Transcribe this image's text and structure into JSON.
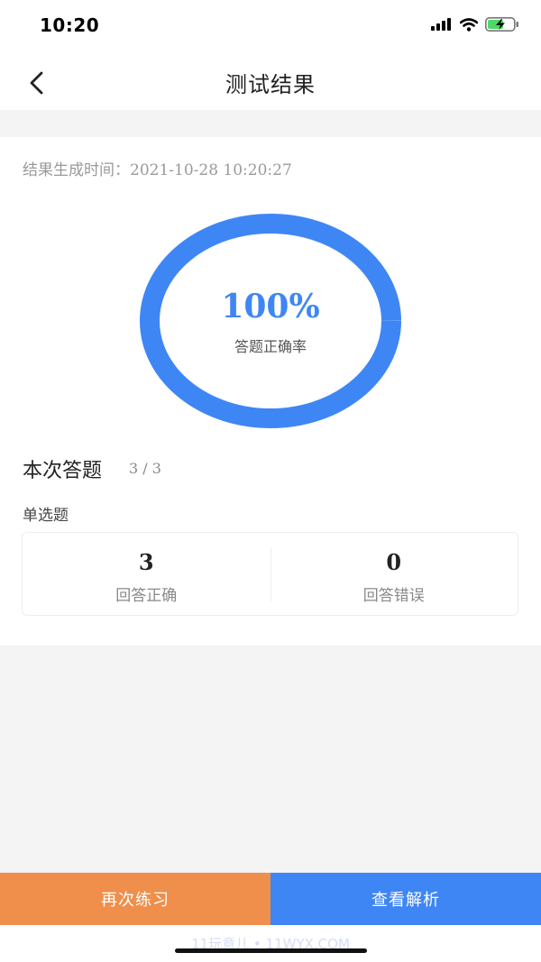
{
  "status_bar": {
    "time": "10:20"
  },
  "header": {
    "title": "测试结果",
    "back_icon": "chevron-left-icon"
  },
  "result": {
    "generated_label": "结果生成时间：",
    "generated_time": "2021-10-28 10:20:27",
    "accuracy": 100,
    "accuracy_text": "100%",
    "accuracy_label": "答题正确率"
  },
  "summary": {
    "title": "本次答题",
    "count": "3 / 3",
    "category": "单选题",
    "stats": [
      {
        "value": "3",
        "label": "回答正确"
      },
      {
        "value": "0",
        "label": "回答错误"
      }
    ]
  },
  "actions": {
    "retry_label": "再次练习",
    "analysis_label": "查看解析"
  },
  "watermark": "11玩意儿 • 11WYX.COM",
  "colors": {
    "accent": "#3f86f5",
    "retry": "#ef8f4b"
  }
}
